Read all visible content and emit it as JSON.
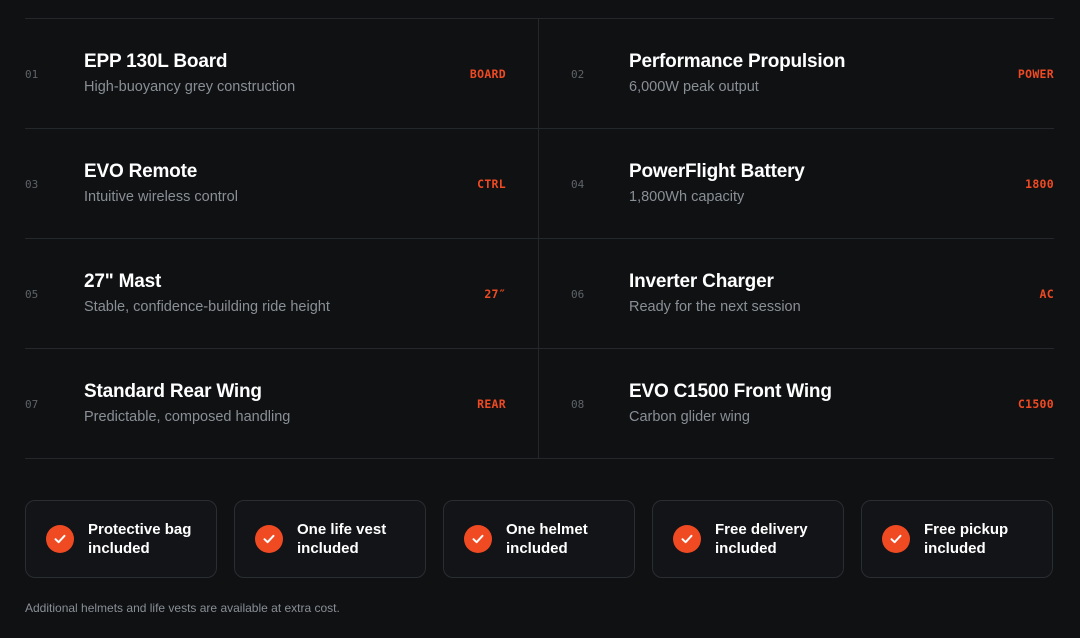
{
  "specs": [
    {
      "num": "01",
      "title": "EPP 130L Board",
      "subtitle": "High-buoyancy grey construction",
      "tag": "BOARD"
    },
    {
      "num": "02",
      "title": "Performance Propulsion",
      "subtitle": "6,000W peak output",
      "tag": "POWER"
    },
    {
      "num": "03",
      "title": "EVO Remote",
      "subtitle": "Intuitive wireless control",
      "tag": "CTRL"
    },
    {
      "num": "04",
      "title": "PowerFlight Battery",
      "subtitle": "1,800Wh capacity",
      "tag": "1800"
    },
    {
      "num": "05",
      "title": "27\" Mast",
      "subtitle": "Stable, confidence-building ride height",
      "tag": "27″"
    },
    {
      "num": "06",
      "title": "Inverter Charger",
      "subtitle": "Ready for the next session",
      "tag": "AC"
    },
    {
      "num": "07",
      "title": "Standard Rear Wing",
      "subtitle": "Predictable, composed handling",
      "tag": "REAR"
    },
    {
      "num": "08",
      "title": "EVO C1500 Front Wing",
      "subtitle": "Carbon glider wing",
      "tag": "C1500"
    }
  ],
  "features": [
    {
      "line1": "Protective bag",
      "line2": "included",
      "icon": "check-circle-icon"
    },
    {
      "line1": "One life vest",
      "line2": "included",
      "icon": "check-circle-icon"
    },
    {
      "line1": "One helmet",
      "line2": "included",
      "icon": "check-circle-icon"
    },
    {
      "line1": "Free delivery",
      "line2": "included",
      "icon": "check-circle-icon"
    },
    {
      "line1": "Free pickup",
      "line2": "included",
      "icon": "check-circle-icon"
    }
  ],
  "footnote": "Additional helmets and life vests are available at extra cost.",
  "colors": {
    "accent": "#f04a23",
    "background": "#0f1113",
    "muted": "#8a8f96"
  }
}
